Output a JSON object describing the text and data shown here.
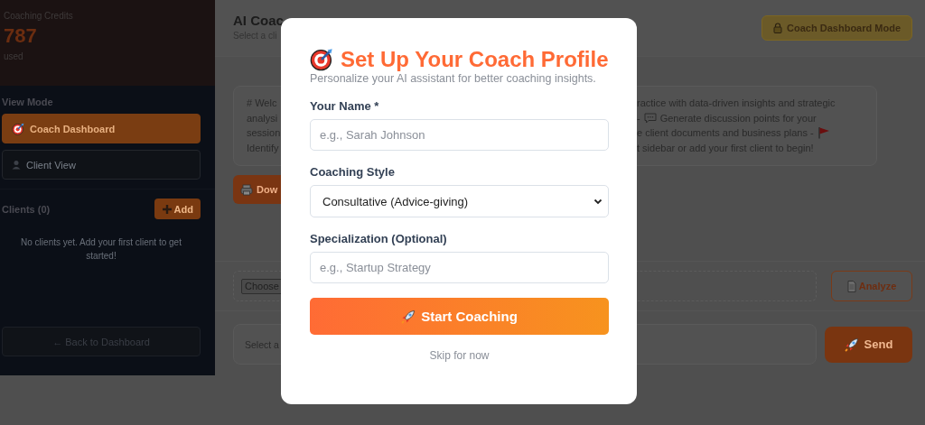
{
  "sidebar": {
    "credits": {
      "label": "Coaching Credits",
      "value": "787",
      "caption": "used"
    },
    "view_mode": {
      "title": "View Mode",
      "options": [
        {
          "label": "Coach Dashboard",
          "selected": true
        },
        {
          "label": "Client View",
          "selected": false
        }
      ]
    },
    "clients": {
      "title": "Clients (0)",
      "add_button": "Add",
      "empty_message": "No clients yet. Add your first client to get started!"
    },
    "back_button": "← Back to Dashboard"
  },
  "header": {
    "title": "AI Coac",
    "subtitle": "Select a cli",
    "mode_badge": "Coach Dashboard Mode"
  },
  "welcome": {
    "left_lines": [
      "# Welc",
      "analysi",
      "session",
      "Identify"
    ],
    "right_lines": [
      {
        "text": "ractice with data-driven insights and strategic"
      },
      {
        "prefix": "-",
        "text": "Generate discussion points for your"
      },
      {
        "text": "e client documents and business plans -"
      },
      {
        "text": "t sidebar or add your first client to begin!"
      }
    ]
  },
  "download_button": "Dow",
  "file_picker": {
    "button": "Choose"
  },
  "analyze_button": "Analyze",
  "message_field": {
    "placeholder": "Select a"
  },
  "send_button": "Send",
  "modal": {
    "title": "Set Up Your Coach Profile",
    "subtitle": "Personalize your AI assistant for better coaching insights.",
    "fields": [
      {
        "kind": "text",
        "label": "Your Name *",
        "placeholder": "e.g., Sarah Johnson"
      },
      {
        "kind": "select",
        "label": "Coaching Style",
        "value": "Consultative (Advice-giving)"
      },
      {
        "kind": "text",
        "label": "Specialization (Optional)",
        "placeholder": "e.g., Startup Strategy"
      }
    ],
    "submit_button": "Start Coaching",
    "skip_link": "Skip for now"
  }
}
